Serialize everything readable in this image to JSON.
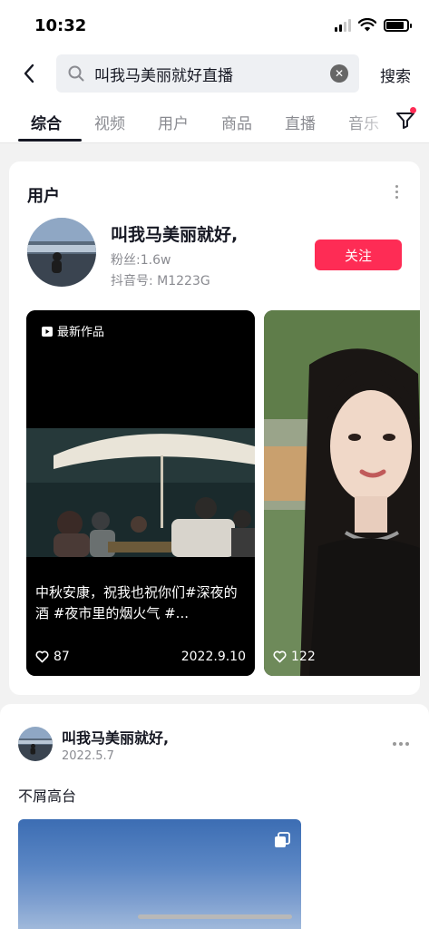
{
  "status_bar": {
    "time": "10:32"
  },
  "search": {
    "query": "叫我马美丽就好直播",
    "button_label": "搜索"
  },
  "tabs": [
    {
      "label": "综合",
      "active": true
    },
    {
      "label": "视频",
      "active": false
    },
    {
      "label": "用户",
      "active": false
    },
    {
      "label": "商品",
      "active": false
    },
    {
      "label": "直播",
      "active": false
    },
    {
      "label": "音乐",
      "active": false
    }
  ],
  "user_section": {
    "title": "用户",
    "name": "叫我马美丽就好,",
    "fans": "粉丝:1.6w",
    "douyin_id": "抖音号: M1223G",
    "follow_label": "关注"
  },
  "works": [
    {
      "badge": "最新作品",
      "caption": "中秋安康，祝我也祝你们#深夜的酒 #夜市里的烟火气 #...",
      "likes": "87",
      "date": "2022.9.10"
    },
    {
      "likes": "122"
    }
  ],
  "post": {
    "name": "叫我马美丽就好,",
    "date": "2022.5.7",
    "text": "不屑高台"
  },
  "colors": {
    "accent": "#fe2c55",
    "text": "#161823",
    "muted": "#8a8b91"
  }
}
